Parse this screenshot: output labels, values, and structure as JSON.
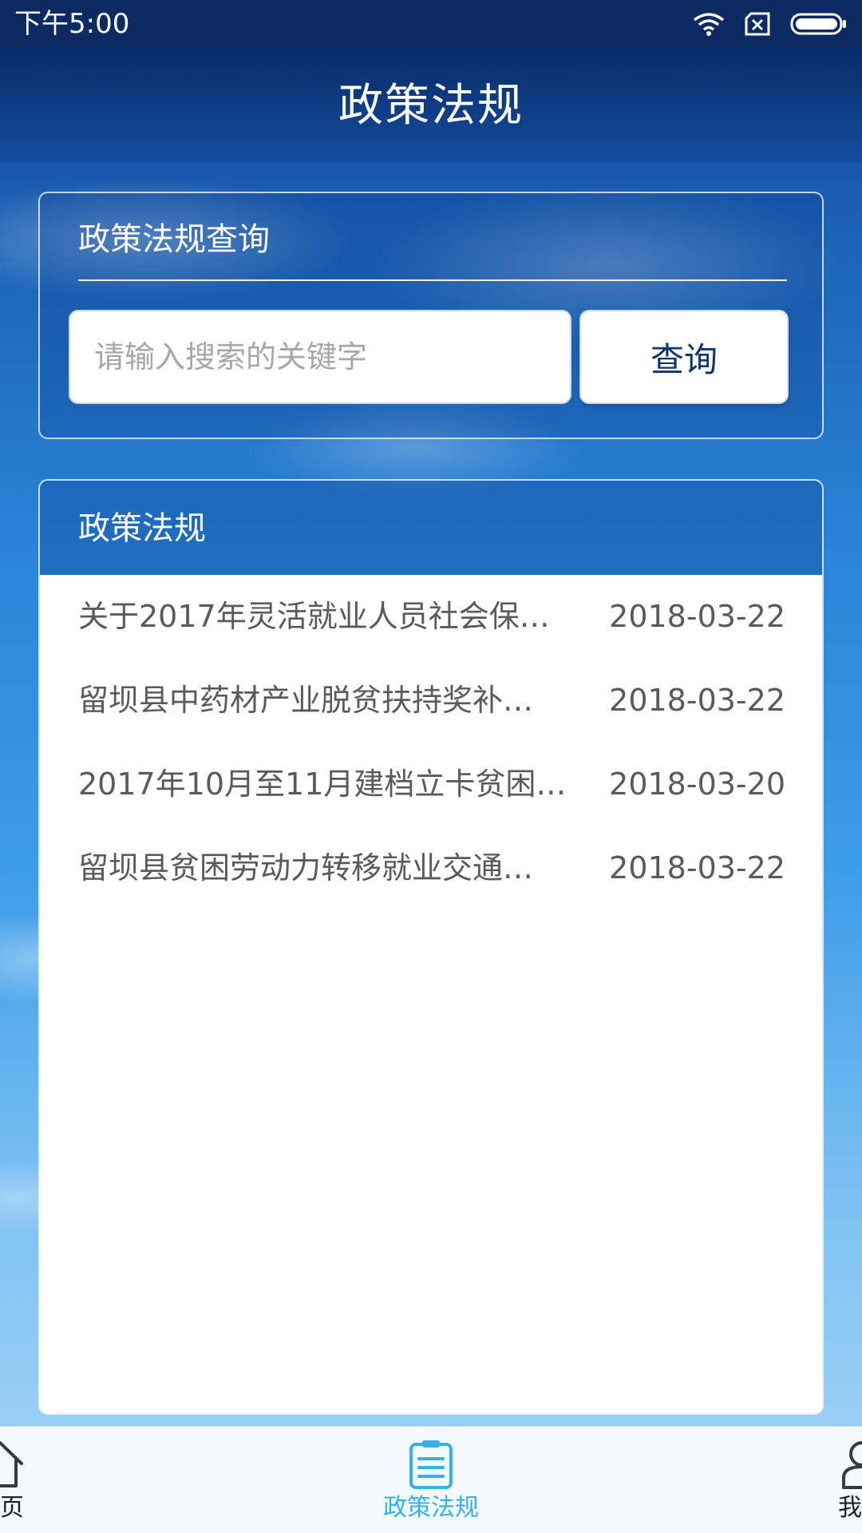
{
  "status_bar": {
    "time": "下午5:00",
    "icons": [
      "wifi-icon",
      "sim-x-icon",
      "battery-icon"
    ]
  },
  "header": {
    "title": "政策法规"
  },
  "search_card": {
    "title": "政策法规查询",
    "placeholder": "请输入搜索的关键字",
    "button_label": "查询"
  },
  "list_card": {
    "title": "政策法规",
    "items": [
      {
        "title": "关于2017年灵活就业人员社会保…",
        "date": "2018-03-22"
      },
      {
        "title": "留坝县中药材产业脱贫扶持奖补…",
        "date": "2018-03-22"
      },
      {
        "title": "2017年10月至11月建档立卡贫困…",
        "date": "2018-03-20"
      },
      {
        "title": "留坝县贫困劳动力转移就业交通…",
        "date": "2018-03-22"
      }
    ]
  },
  "bottom_nav": {
    "items": [
      {
        "label": "首页",
        "icon": "home-icon"
      },
      {
        "label": "政策法规",
        "icon": "document-icon",
        "active": true
      },
      {
        "label": "我的",
        "icon": "user-icon"
      }
    ],
    "active_color": "#36b0e8"
  }
}
